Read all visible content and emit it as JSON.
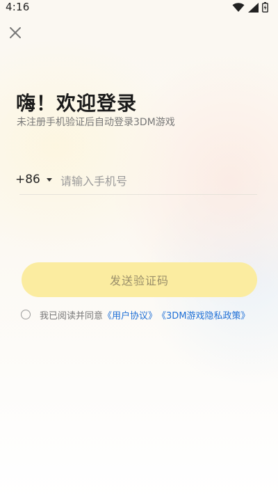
{
  "status_bar": {
    "time": "4:16",
    "icons": [
      "wifi-icon",
      "signal-icon",
      "battery-icon"
    ]
  },
  "close": {
    "icon": "close-icon"
  },
  "title": "嗨！欢迎登录",
  "subtitle": "未注册手机验证后自动登录3DM游戏",
  "phone": {
    "country_code": "+86",
    "placeholder": "请输入手机号",
    "value": ""
  },
  "send_code": {
    "label": "发送验证码"
  },
  "agreement": {
    "prefix": "我已阅读并同意",
    "user_agreement": "《用户协议》",
    "privacy_policy": "《3DM游戏隐私政策》",
    "checked": false
  },
  "colors": {
    "button_bg": "#fbeca0",
    "button_text": "#9a8f6a",
    "link": "#1e6fd6",
    "title": "#1a1a1a",
    "subtitle": "#777777"
  }
}
